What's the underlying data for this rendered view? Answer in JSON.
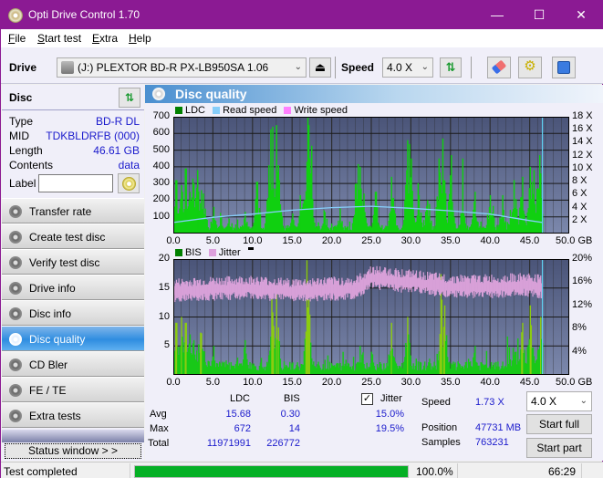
{
  "window": {
    "title": "Opti Drive Control 1.70",
    "minimize": "—",
    "maximize": "☐",
    "close": "✕"
  },
  "menu": [
    {
      "label": "File",
      "accel": "F",
      "rest": "ile"
    },
    {
      "label": "Start test",
      "accel": "S",
      "rest": "tart test"
    },
    {
      "label": "Extra",
      "accel": "E",
      "rest": "xtra"
    },
    {
      "label": "Help",
      "accel": "H",
      "rest": "elp"
    }
  ],
  "toolbar": {
    "drive_label": "Drive",
    "drive_value": "(J:)  PLEXTOR BD-R  PX-LB950SA 1.06",
    "speed_label": "Speed",
    "speed_value": "4.0 X",
    "icons": [
      "drive-icon",
      "eject-icon",
      "swap-icon",
      "eraser-icon",
      "settings-icon",
      "save-icon"
    ]
  },
  "disc": {
    "title": "Disc",
    "rows": [
      {
        "key": "Type",
        "value": "BD-R DL"
      },
      {
        "key": "MID",
        "value": "TDKBLDRFB (000)"
      },
      {
        "key": "Length",
        "value": "46.61 GB"
      },
      {
        "key": "Contents",
        "value": "data"
      }
    ],
    "label_key": "Label",
    "label_value": ""
  },
  "nav": [
    {
      "label": "Transfer rate",
      "active": false
    },
    {
      "label": "Create test disc",
      "active": false
    },
    {
      "label": "Verify test disc",
      "active": false
    },
    {
      "label": "Drive info",
      "active": false
    },
    {
      "label": "Disc info",
      "active": false
    },
    {
      "label": "Disc quality",
      "active": true
    },
    {
      "label": "CD Bler",
      "active": false
    },
    {
      "label": "FE / TE",
      "active": false
    },
    {
      "label": "Extra tests",
      "active": false
    }
  ],
  "status_window_button": "Status window > >",
  "panel": {
    "title": "Disc quality"
  },
  "chart_data": [
    {
      "type": "bar",
      "title": "",
      "legend": [
        {
          "name": "LDC",
          "color": "#008000"
        },
        {
          "name": "Read speed",
          "color": "#87cefa"
        },
        {
          "name": "Write speed",
          "color": "#ff80ff"
        }
      ],
      "legend_position": "top-left",
      "xlabel": "GB",
      "xlim": [
        0,
        50
      ],
      "x_ticks": [
        "0.0",
        "5.0",
        "10.0",
        "15.0",
        "20.0",
        "25.0",
        "30.0",
        "35.0",
        "40.0",
        "45.0",
        "50.0 GB"
      ],
      "ylim": [
        0,
        700
      ],
      "y_ticks": [
        "100",
        "200",
        "300",
        "400",
        "500",
        "600",
        "700"
      ],
      "y2lim": [
        0,
        18
      ],
      "y2_ticks": [
        "2 X",
        "4 X",
        "6 X",
        "8 X",
        "10 X",
        "12 X",
        "14 X",
        "16 X",
        "18 X"
      ],
      "grid": true,
      "end_marker_gb": 46.61,
      "ldc_peaks": [
        {
          "x": 0.3,
          "y": 320
        },
        {
          "x": 1.0,
          "y": 290
        },
        {
          "x": 1.5,
          "y": 390
        },
        {
          "x": 2.0,
          "y": 250
        },
        {
          "x": 2.4,
          "y": 330
        },
        {
          "x": 3.0,
          "y": 380
        },
        {
          "x": 3.5,
          "y": 260
        },
        {
          "x": 4.0,
          "y": 150
        },
        {
          "x": 5.0,
          "y": 160
        },
        {
          "x": 6.0,
          "y": 100
        },
        {
          "x": 7.0,
          "y": 90
        },
        {
          "x": 9.0,
          "y": 130
        },
        {
          "x": 10.5,
          "y": 310
        },
        {
          "x": 12.0,
          "y": 410
        },
        {
          "x": 12.5,
          "y": 640
        },
        {
          "x": 13.0,
          "y": 650
        },
        {
          "x": 13.3,
          "y": 320
        },
        {
          "x": 15.0,
          "y": 120
        },
        {
          "x": 16.0,
          "y": 230
        },
        {
          "x": 16.8,
          "y": 430
        },
        {
          "x": 17.0,
          "y": 650
        },
        {
          "x": 17.3,
          "y": 360
        },
        {
          "x": 19.0,
          "y": 140
        },
        {
          "x": 21.0,
          "y": 150
        },
        {
          "x": 23.0,
          "y": 300
        },
        {
          "x": 23.5,
          "y": 400
        },
        {
          "x": 24.0,
          "y": 240
        },
        {
          "x": 25.5,
          "y": 250
        },
        {
          "x": 27.5,
          "y": 340
        },
        {
          "x": 29.5,
          "y": 560
        },
        {
          "x": 30.0,
          "y": 450
        },
        {
          "x": 31.0,
          "y": 230
        },
        {
          "x": 32.0,
          "y": 200
        },
        {
          "x": 33.5,
          "y": 450
        },
        {
          "x": 34.0,
          "y": 570
        },
        {
          "x": 35.0,
          "y": 470
        },
        {
          "x": 36.5,
          "y": 250
        },
        {
          "x": 38.0,
          "y": 250
        },
        {
          "x": 40.0,
          "y": 230
        },
        {
          "x": 41.5,
          "y": 230
        },
        {
          "x": 43.0,
          "y": 320
        },
        {
          "x": 44.0,
          "y": 340
        },
        {
          "x": 45.0,
          "y": 400
        },
        {
          "x": 45.5,
          "y": 380
        },
        {
          "x": 46.2,
          "y": 470
        }
      ],
      "read_speed": [
        {
          "x": 0,
          "y": 1.7
        },
        {
          "x": 5,
          "y": 2.5
        },
        {
          "x": 10,
          "y": 3.0
        },
        {
          "x": 15,
          "y": 3.6
        },
        {
          "x": 20,
          "y": 4.0
        },
        {
          "x": 25,
          "y": 4.2
        },
        {
          "x": 30,
          "y": 3.9
        },
        {
          "x": 35,
          "y": 3.5
        },
        {
          "x": 40,
          "y": 3.0
        },
        {
          "x": 45,
          "y": 2.0
        },
        {
          "x": 46.61,
          "y": 1.7
        }
      ]
    },
    {
      "type": "bar",
      "title": "",
      "legend": [
        {
          "name": "BIS",
          "color": "#008000"
        },
        {
          "name": "Jitter",
          "color": "#dda0dd"
        }
      ],
      "legend_position": "top-left",
      "xlabel": "GB",
      "xlim": [
        0,
        50
      ],
      "x_ticks": [
        "0.0",
        "5.0",
        "10.0",
        "15.0",
        "20.0",
        "25.0",
        "30.0",
        "35.0",
        "40.0",
        "45.0",
        "50.0 GB"
      ],
      "ylim": [
        0,
        20
      ],
      "y_ticks": [
        "5",
        "10",
        "15",
        "20"
      ],
      "y2lim": [
        0,
        20
      ],
      "y2_ticks": [
        "4%",
        "8%",
        "12%",
        "16%",
        "20%"
      ],
      "grid": true,
      "end_marker_gb": 46.61,
      "bis_peaks": [
        {
          "x": 0.3,
          "y": 9
        },
        {
          "x": 1.0,
          "y": 10
        },
        {
          "x": 1.5,
          "y": 9
        },
        {
          "x": 2.0,
          "y": 7
        },
        {
          "x": 2.5,
          "y": 6
        },
        {
          "x": 3.5,
          "y": 4
        },
        {
          "x": 5.0,
          "y": 5
        },
        {
          "x": 8.0,
          "y": 3
        },
        {
          "x": 9.0,
          "y": 6
        },
        {
          "x": 12.4,
          "y": 14
        },
        {
          "x": 13.0,
          "y": 14
        },
        {
          "x": 16.8,
          "y": 11
        },
        {
          "x": 17.0,
          "y": 13
        },
        {
          "x": 23.5,
          "y": 5
        },
        {
          "x": 25.0,
          "y": 4
        },
        {
          "x": 27.5,
          "y": 9
        },
        {
          "x": 29.5,
          "y": 10
        },
        {
          "x": 33.8,
          "y": 13
        },
        {
          "x": 34.2,
          "y": 12
        },
        {
          "x": 38.0,
          "y": 5
        },
        {
          "x": 44.0,
          "y": 9
        },
        {
          "x": 45.0,
          "y": 12
        },
        {
          "x": 46.3,
          "y": 10
        }
      ],
      "jitter": [
        {
          "x": 0,
          "y": 14.5
        },
        {
          "x": 5,
          "y": 14.8
        },
        {
          "x": 10,
          "y": 15.0
        },
        {
          "x": 15,
          "y": 14.5
        },
        {
          "x": 20,
          "y": 14.8
        },
        {
          "x": 23,
          "y": 14.8
        },
        {
          "x": 25,
          "y": 16.8
        },
        {
          "x": 30,
          "y": 16.0
        },
        {
          "x": 35,
          "y": 15.2
        },
        {
          "x": 40,
          "y": 15.2
        },
        {
          "x": 45,
          "y": 15.5
        },
        {
          "x": 46.61,
          "y": 15.0
        }
      ]
    }
  ],
  "stats": {
    "col_ldc": "LDC",
    "col_bis": "BIS",
    "jitter_checked": true,
    "jitter_label": "Jitter",
    "rows": [
      {
        "label": "Avg",
        "ldc": "15.68",
        "bis": "0.30",
        "jitter": "15.0%"
      },
      {
        "label": "Max",
        "ldc": "672",
        "bis": "14",
        "jitter": "19.5%"
      },
      {
        "label": "Total",
        "ldc": "11971991",
        "bis": "226772",
        "jitter": ""
      }
    ],
    "speed_label": "Speed",
    "speed_value": "1.73 X",
    "position_label": "Position",
    "position_value": "47731 MB",
    "samples_label": "Samples",
    "samples_value": "763231",
    "speed_select": "4.0 X",
    "start_full": "Start full",
    "start_part": "Start part"
  },
  "statusbar": {
    "message": "Test completed",
    "progress": 100.0,
    "progress_text": "100.0%",
    "elapsed": "66:29"
  }
}
